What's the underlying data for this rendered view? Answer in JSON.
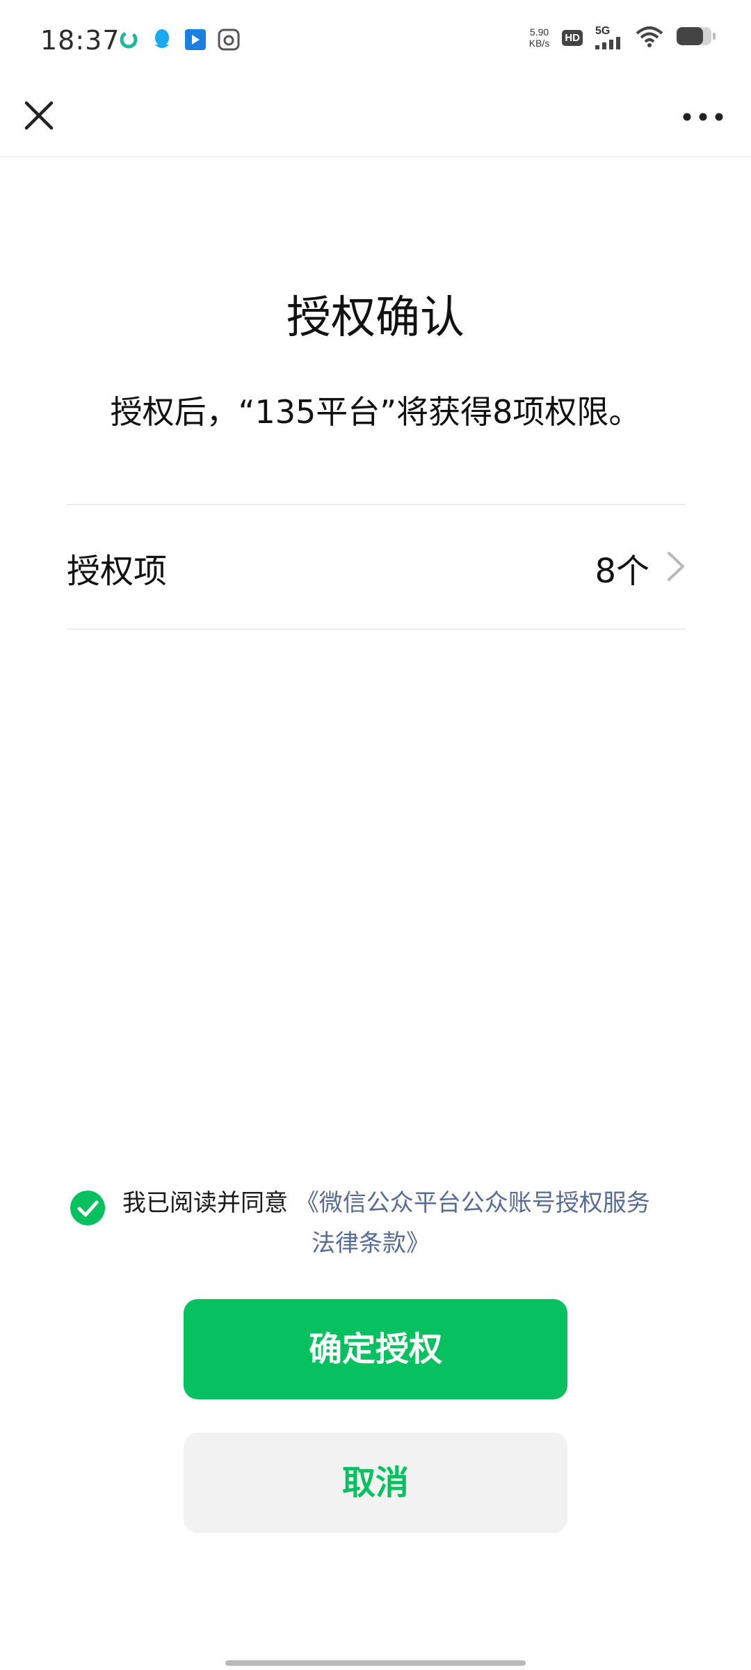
{
  "status_bar": {
    "time": "18:37",
    "network_speed_value": "5.90",
    "network_speed_unit": "KB/s",
    "hd_label": "HD",
    "signal_label": "5G",
    "battery_level": 0.75,
    "notification_icons": [
      "circle-app-icon",
      "qq-icon",
      "video-app-icon",
      "camera-app-icon"
    ]
  },
  "nav": {
    "close_icon": "close-icon",
    "more_icon": "more-icon"
  },
  "main": {
    "title": "授权确认",
    "subtitle": "授权后，“135平台”将获得8项权限。",
    "auth_item": {
      "label": "授权项",
      "value": "8个"
    }
  },
  "agreement": {
    "checked": true,
    "prefix": "我已阅读并同意",
    "link_line1": "《微信公众平台公众账号授权服务",
    "link_line2": "法律条款》"
  },
  "buttons": {
    "confirm_label": "确定授权",
    "cancel_label": "取消"
  },
  "colors": {
    "accent": "#07c160",
    "link": "#576b95",
    "cancel_bg": "#f2f2f2"
  }
}
